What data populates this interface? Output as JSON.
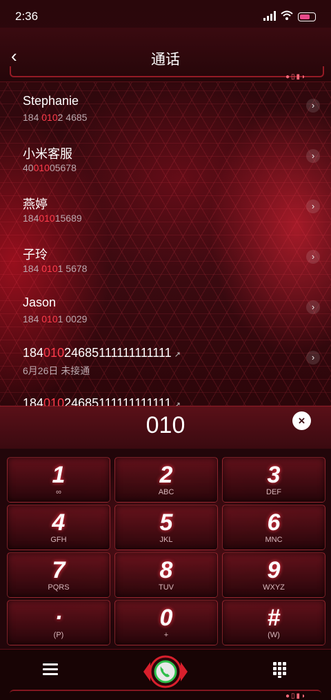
{
  "status": {
    "time": "2:36"
  },
  "header": {
    "back": "‹",
    "title": "通话"
  },
  "list": [
    {
      "name": "Stephanie",
      "num_pre": "184 ",
      "num_hl": "010",
      "num_post": "2 4685",
      "extra": ""
    },
    {
      "name": "小米客服",
      "num_pre": "40",
      "num_hl": "010",
      "num_post": "05678",
      "extra": ""
    },
    {
      "name": "燕婷",
      "num_pre": "184",
      "num_hl": "010",
      "num_post": "15689",
      "extra": ""
    },
    {
      "name": "子玲",
      "num_pre": "184 ",
      "num_hl": "010",
      "num_post": "1 5678",
      "extra": ""
    },
    {
      "name": "Jason",
      "num_pre": "184 ",
      "num_hl": "010",
      "num_post": "1 0029",
      "extra": ""
    },
    {
      "name": "18401024685111111111111",
      "num_pre": "6月26日 未接通",
      "num_hl": "",
      "num_post": "",
      "extra": "↗"
    },
    {
      "name": "18401024685111111111111",
      "num_pre": "",
      "num_hl": "",
      "num_post": "",
      "extra": "↗"
    }
  ],
  "dialer": {
    "digits": "010",
    "clear": "×"
  },
  "keys": [
    {
      "d": "1",
      "l": "∞"
    },
    {
      "d": "2",
      "l": "ABC"
    },
    {
      "d": "3",
      "l": "DEF"
    },
    {
      "d": "4",
      "l": "GFH"
    },
    {
      "d": "5",
      "l": "JKL"
    },
    {
      "d": "6",
      "l": "MNC"
    },
    {
      "d": "7",
      "l": "PQRS"
    },
    {
      "d": "8",
      "l": "TUV"
    },
    {
      "d": "9",
      "l": "WXYZ"
    },
    {
      "d": "·",
      "l": "(P)"
    },
    {
      "d": "0",
      "l": "+"
    },
    {
      "d": "#",
      "l": "(W)"
    }
  ],
  "icons": {
    "back": "back-arrow-icon",
    "menu": "menu-icon",
    "call": "phone-call-icon",
    "keypad": "keypad-icon"
  },
  "colors": {
    "accent": "#ff3b4b",
    "background": "#2a070b"
  }
}
